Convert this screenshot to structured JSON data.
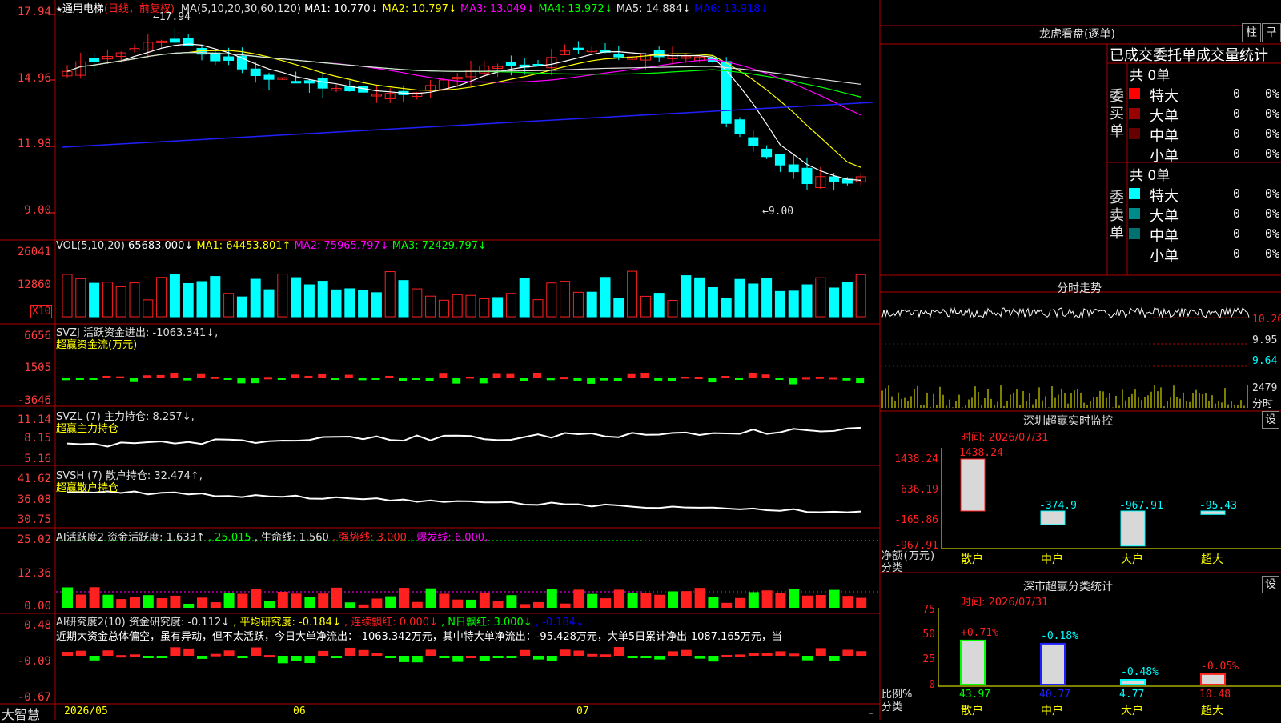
{
  "stock": {
    "name": "通用电梯",
    "period": "(日线，前复权)",
    "ma_header": [
      {
        "label": "MA(5,10,20,30,60,120)",
        "color": "#e0e0e0"
      },
      {
        "label": "MA1: 10.770↓",
        "color": "#ffffff"
      },
      {
        "label": "MA2: 10.797↓",
        "color": "#ffff00"
      },
      {
        "label": "MA3: 13.049↓",
        "color": "#ff00ff"
      },
      {
        "label": "MA4: 13.972↓",
        "color": "#00ff00"
      },
      {
        "label": "MA5: 14.884↓",
        "color": "#e0e0e0"
      },
      {
        "label": "MA6: 13.918↓",
        "color": "#0000ff"
      }
    ],
    "price_axis": [
      "17.94",
      "14.96",
      "11.98",
      "9.00"
    ],
    "high_label": "17.94",
    "low_label": "9.00"
  },
  "vol": {
    "header": [
      {
        "label": "VOL(5,10,20)",
        "color": "#e0e0e0"
      },
      {
        "label": "65683.000↓",
        "color": "#ffffff"
      },
      {
        "label": "MA1: 64453.801↑",
        "color": "#ffff00"
      },
      {
        "label": "MA2: 75965.797↓",
        "color": "#ff00ff"
      },
      {
        "label": "MA3: 72429.797↓",
        "color": "#00ff00"
      }
    ],
    "axis": [
      "26041",
      "12860"
    ],
    "unit": "X10"
  },
  "svzj": {
    "header": [
      {
        "label": "SVZJ  活跃资金进出: -1063.341↓,",
        "color": "#e0e0e0"
      }
    ],
    "sub": "超赢资金流(万元)",
    "axis": [
      "6656",
      "1505",
      "-3646"
    ]
  },
  "svzl": {
    "header": [
      {
        "label": "SVZL (7) 主力持仓: 8.257↓,",
        "color": "#e0e0e0"
      }
    ],
    "sub": "超赢主力持仓",
    "axis": [
      "11.14",
      "8.15",
      "5.16"
    ]
  },
  "svsh": {
    "header": [
      {
        "label": "SVSH (7) 散户持仓: 32.474↑,",
        "color": "#e0e0e0"
      }
    ],
    "sub": "超赢散户持仓",
    "axis": [
      "41.62",
      "36.08",
      "30.75"
    ]
  },
  "ai_active": {
    "header": [
      {
        "label": "AI活跃度2 资金活跃度: 1.633↑",
        "color": "#e0e0e0"
      },
      {
        "label": ", 25.015",
        "color": "#00ff00"
      },
      {
        "label": ", 生命线: 1.560",
        "color": "#e0e0e0"
      },
      {
        "label": ", 强势线: 3.000",
        "color": "#ff2020"
      },
      {
        "label": ", 爆发线: 6.000,",
        "color": "#ff00ff"
      }
    ],
    "axis": [
      "25.02",
      "12.36",
      "0.00"
    ]
  },
  "ai_research": {
    "header": [
      {
        "label": "AI研究度2(10) 资金研究度: -0.112↓",
        "color": "#e0e0e0"
      },
      {
        "label": ", 平均研究度: -0.184↓",
        "color": "#ffff00"
      },
      {
        "label": ", 连续飘红: 0.000↓",
        "color": "#ff2020"
      },
      {
        "label": ", N日飘红: 3.000↓",
        "color": "#00ff00"
      },
      {
        "label": ", -0.184↓",
        "color": "#0000ff"
      }
    ],
    "comment": "近期大资金总体偏空，虽有异动，但不太活跃，今日大单净流出：-1063.342万元，其中特大单净流出：-95.428万元，大单5日累计净出-1087.165万元，当",
    "axis": [
      "0.48",
      "-0.09",
      "-0.67"
    ]
  },
  "date_axis": {
    "brand": "大智慧",
    "labels": [
      "2026/05",
      "06",
      "07"
    ]
  },
  "dragon": {
    "title": "龙虎看盘(逐单)",
    "btn1": "柱",
    "btn2": "구",
    "subtitle": "已成交委托单成交量统计",
    "buy_label": "委买单",
    "sell_label": "委卖单",
    "buy_total": "共 0单",
    "sell_total": "共 0单",
    "buy_rows": [
      {
        "name": "特大",
        "count": "0",
        "pct": "0%",
        "color": "#ff0000"
      },
      {
        "name": "大单",
        "count": "0",
        "pct": "0%",
        "color": "#990000"
      },
      {
        "name": "中单",
        "count": "0",
        "pct": "0%",
        "color": "#660000"
      },
      {
        "name": "小单",
        "count": "0",
        "pct": "0%",
        "color": ""
      }
    ],
    "sell_rows": [
      {
        "name": "特大",
        "count": "0",
        "pct": "0%",
        "color": "#00ffff"
      },
      {
        "name": "大单",
        "count": "0",
        "pct": "0%",
        "color": "#008b8b"
      },
      {
        "name": "中单",
        "count": "0",
        "pct": "0%",
        "color": "#007070"
      },
      {
        "name": "小单",
        "count": "0",
        "pct": "0%",
        "color": ""
      }
    ]
  },
  "intraday": {
    "title": "分时走势",
    "axis": [
      "10.26",
      "9.95",
      "9.64"
    ],
    "vol_axis": [
      "2479",
      "分时"
    ]
  },
  "sz_monitor": {
    "title": "深圳超赢实时监控",
    "settings": "设",
    "time": "时间: 2026/07/31",
    "axis": [
      "1438.24",
      "636.19",
      "-165.86",
      "-967.91"
    ],
    "unit": "净额(万元)",
    "cat_label": "分类",
    "categories": [
      "散户",
      "中户",
      "大户",
      "超大"
    ],
    "values": [
      "1438.24",
      "-374.9",
      "-967.91",
      "-95.43"
    ]
  },
  "sz_class": {
    "title": "深市超赢分类统计",
    "settings": "设",
    "time": "时间: 2026/07/31",
    "axis": [
      "75",
      "50",
      "25",
      "0"
    ],
    "unit": "比例%",
    "cat_label": "分类",
    "categories": [
      "散户",
      "中户",
      "大户",
      "超大"
    ],
    "values": [
      "43.97",
      "40.77",
      "4.77",
      "10.48"
    ],
    "changes": [
      "+0.71%",
      "-0.18%",
      "-0.48%",
      "-0.05%"
    ]
  }
}
